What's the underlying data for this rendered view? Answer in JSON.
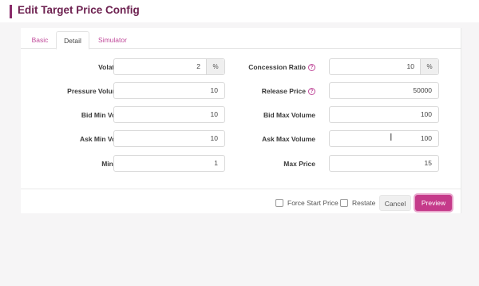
{
  "dialog": {
    "title": "Edit Target Price Config"
  },
  "tabs": [
    {
      "label": "Basic"
    },
    {
      "label": "Detail"
    },
    {
      "label": "Simulator"
    }
  ],
  "fields": {
    "volatility": {
      "label": "Volatility/s",
      "value": "2",
      "addon": "%"
    },
    "concession_ratio": {
      "label": "Concession Ratio",
      "value": "10",
      "addon": "%"
    },
    "pressure_volume": {
      "label": "Pressure Volume",
      "value": "10"
    },
    "release_price": {
      "label": "Release Price",
      "value": "50000"
    },
    "bid_min_volume": {
      "label": "Bid Min Volume",
      "value": "10"
    },
    "bid_max_volume": {
      "label": "Bid Max Volume",
      "value": "100"
    },
    "ask_min_volume": {
      "label": "Ask Min Volume",
      "value": "10"
    },
    "ask_max_volume": {
      "label": "Ask Max Volume",
      "value": "100"
    },
    "min_price": {
      "label": "Min Price",
      "value": "1"
    },
    "max_price": {
      "label": "Max Price",
      "value": "15"
    }
  },
  "help_glyph": "?",
  "footer": {
    "force_start_price": "Force Start Price",
    "restate": "Restate",
    "cancel": "Cancel",
    "preview": "Preview"
  },
  "colors": {
    "accent": "#c53a8a",
    "title": "#6d2150",
    "tab_link": "#c04a9a"
  }
}
